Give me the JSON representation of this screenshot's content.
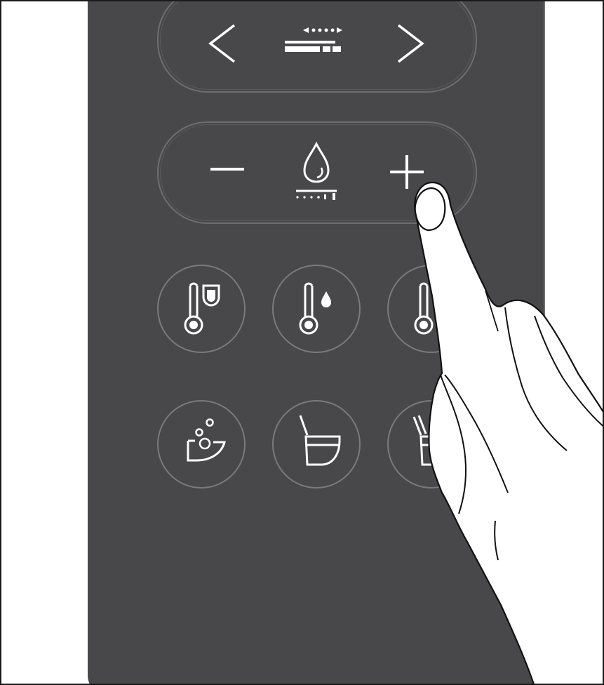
{
  "colors": {
    "background": "#ffffff",
    "panel": "#48484a",
    "icon_stroke": "#ffffff",
    "outline": "#6e6e70",
    "hand_outline": "#111111"
  },
  "nav_row": {
    "prev_icon": "chevron-left-icon",
    "mode_icon": "spray-position-icon",
    "next_icon": "chevron-right-icon"
  },
  "pressure_row": {
    "decrease_icon": "minus-icon",
    "center_icon": "water-drop-pressure-icon",
    "increase_icon": "plus-icon"
  },
  "temperature_buttons": [
    {
      "icon": "seat-temperature-icon"
    },
    {
      "icon": "water-temperature-icon"
    },
    {
      "icon": "dryer-temperature-icon"
    }
  ],
  "function_buttons": [
    {
      "icon": "bowl-bubbles-icon"
    },
    {
      "icon": "lid-open-icon"
    },
    {
      "icon": "seat-lid-open-icon"
    }
  ],
  "hand_icon": "pointing-hand-icon"
}
